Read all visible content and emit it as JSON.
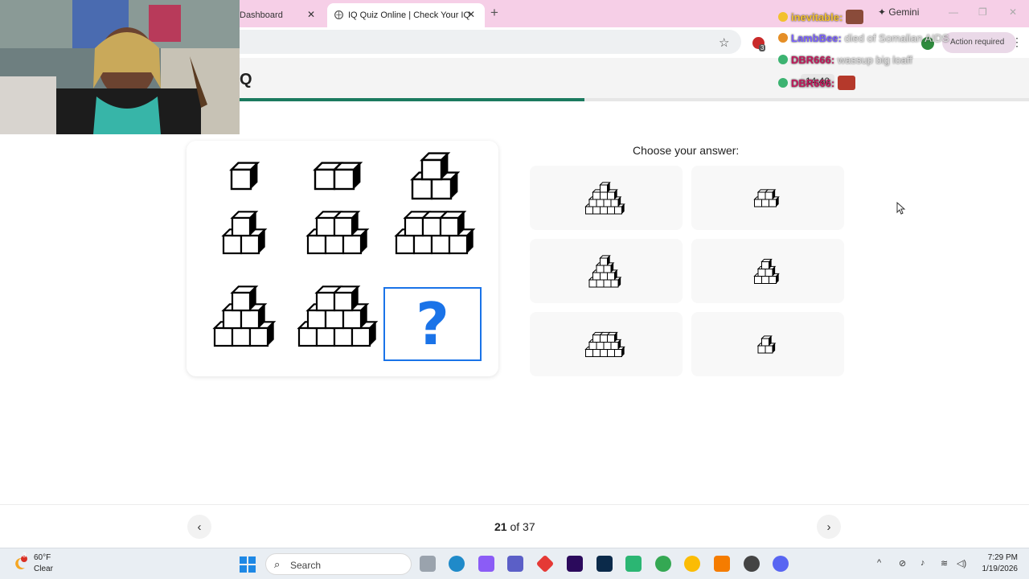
{
  "browser": {
    "tabs": [
      {
        "label": "Dashboard",
        "close": "✕"
      },
      {
        "label": "IQ Quiz Online | Check Your IQ",
        "close": "✕",
        "active": true
      }
    ],
    "new_tab": "+",
    "gemini_label": "Gemini",
    "action_label": "Action required",
    "extension_count": "3",
    "window_controls": {
      "minimize": "—",
      "restore": "❐",
      "close": "✕"
    }
  },
  "site": {
    "logo_text": "Q",
    "timer": "14:40",
    "progress_fraction": 0.437
  },
  "question": {
    "placeholder_mark": "?",
    "cube_counts": [
      [
        1,
        2,
        3
      ],
      [
        3,
        5,
        7
      ],
      [
        6,
        9,
        null
      ]
    ]
  },
  "answers": {
    "heading": "Choose your answer:",
    "options": [
      {
        "label": "option-1",
        "cubes": 13
      },
      {
        "label": "option-2",
        "cubes": 5
      },
      {
        "label": "option-3",
        "cubes": 10
      },
      {
        "label": "option-4",
        "cubes": 6
      },
      {
        "label": "option-5",
        "cubes": 12
      },
      {
        "label": "option-6",
        "cubes": 3
      }
    ]
  },
  "pagination": {
    "current": "21",
    "separator": " of ",
    "total": "37",
    "prev_icon": "‹",
    "next_icon": "›"
  },
  "taskbar": {
    "weather_temp": "60°F",
    "weather_condition": "Clear",
    "weather_badge": "3",
    "search_placeholder": "Search",
    "time": "7:29 PM",
    "date": "1/19/2026"
  },
  "chat": [
    {
      "user": "inevitable",
      "message": "",
      "color": "#f2c12e"
    },
    {
      "user": "LambBee",
      "message": "died of Somalian AIDS",
      "color": "#7b61ff"
    },
    {
      "user": "DBR666",
      "message": "wassup big loaff",
      "color": "#c2185b"
    },
    {
      "user": "DBR666",
      "message": "",
      "color": "#c2185b"
    }
  ],
  "colors": {
    "accent": "#1a73e8",
    "progress": "#1b7a5f",
    "tab_strip": "#f6cfe7"
  }
}
